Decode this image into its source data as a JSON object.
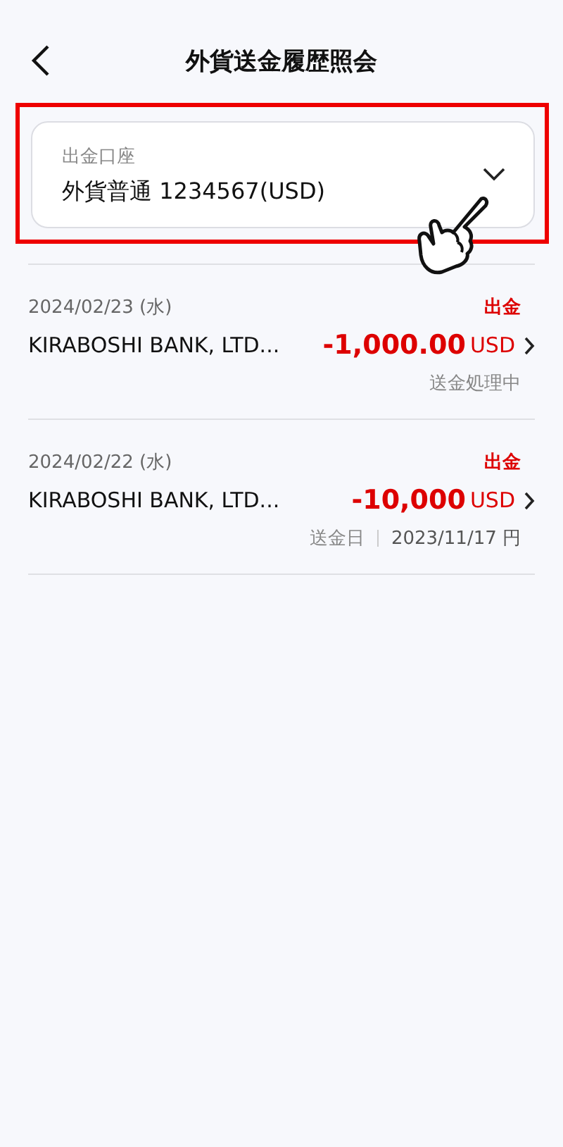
{
  "header": {
    "title": "外貨送金履歴照会"
  },
  "account_select": {
    "label": "出金口座",
    "value": "外貨普通 1234567(USD)",
    "highlighted": true
  },
  "transactions": [
    {
      "date": "2024/02/23 (水)",
      "type": "出金",
      "name": "KIRABOSHI BANK, LTD...",
      "amount": "-1,000.00",
      "currency": "USD",
      "kind": "status",
      "status": "送金処理中"
    },
    {
      "date": "2024/02/22 (水)",
      "type": "出金",
      "name": "KIRABOSHI BANK, LTD...",
      "amount": "-10,000",
      "currency": "USD",
      "kind": "date",
      "date_label": "送金日",
      "sent_date": "2023/11/17 円"
    }
  ]
}
